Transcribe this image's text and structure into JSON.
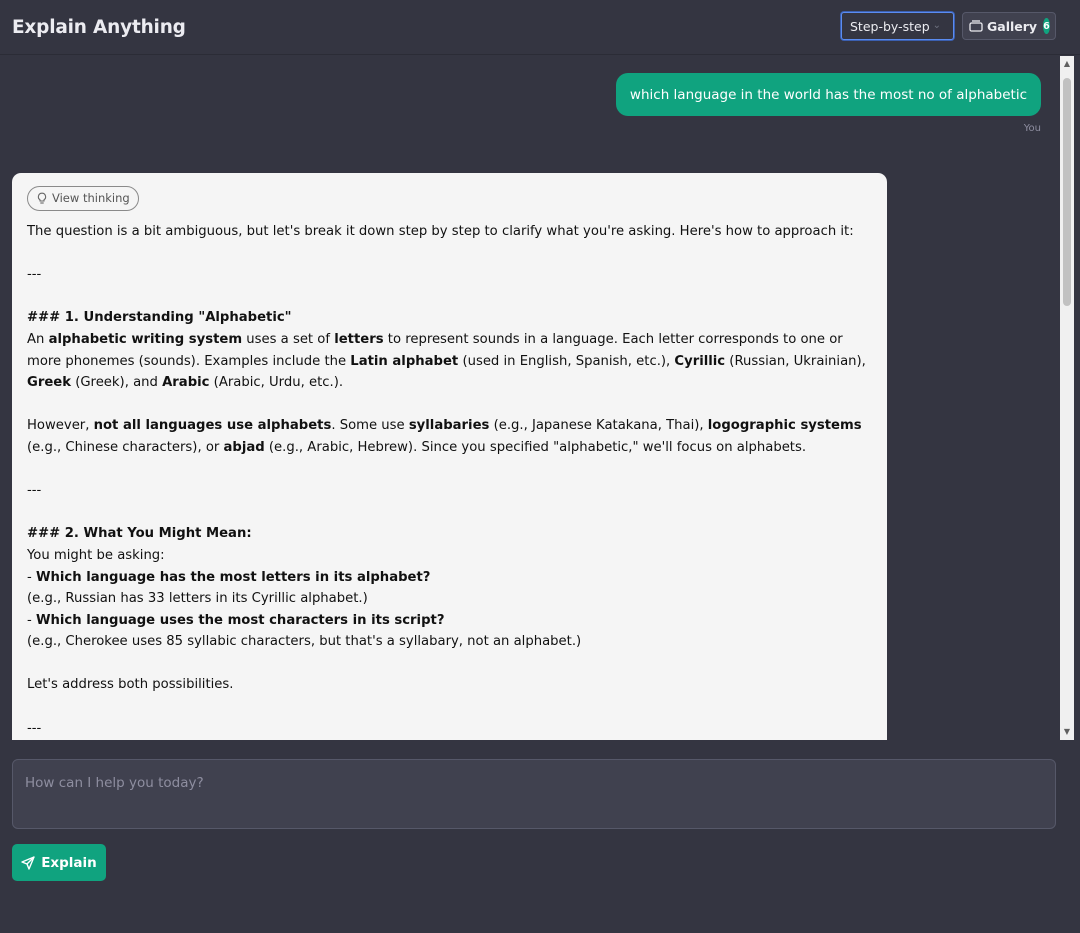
{
  "header": {
    "title": "Explain Anything",
    "mode_select": {
      "selected": "Step-by-step"
    },
    "gallery": {
      "label": "Gallery",
      "count": "6"
    }
  },
  "chat": {
    "user_message": "which language in the world has the most no of alphabetic",
    "user_label": "You",
    "assistant": {
      "thinking_label": "View thinking",
      "intro": "The question is a bit ambiguous, but let's break it down step by step to clarify what you're asking. Here's how to approach it:",
      "sep": "---",
      "s1_heading": "### 1. Understanding \"Alphabetic\"",
      "s1_p1": {
        "t1": "An ",
        "b1": "alphabetic writing system",
        "t2": " uses a set of ",
        "b2": "letters",
        "t3": " to represent sounds in a language. Each letter corresponds to one or more phonemes (sounds). Examples include the ",
        "b3": "Latin alphabet",
        "t4": " (used in English, Spanish, etc.), ",
        "b4": "Cyrillic",
        "t5": " (Russian, Ukrainian), ",
        "b5": "Greek",
        "t6": " (Greek), and ",
        "b6": "Arabic",
        "t7": " (Arabic, Urdu, etc.)."
      },
      "s1_p2": {
        "t1": "However, ",
        "b1": "not all languages use alphabets",
        "t2": ". Some use ",
        "b2": "syllabaries",
        "t3": " (e.g., Japanese Katakana, Thai), ",
        "b3": "logographic systems",
        "t4": " (e.g., Chinese characters), or ",
        "b4": "abjad",
        "t5": " (e.g., Arabic, Hebrew). Since you specified \"alphabetic,\" we'll focus on alphabets."
      },
      "s2_heading": "### 2. What You Might Mean:",
      "s2_intro": "You might be asking:",
      "s2_item1_prefix": "- ",
      "s2_item1": "Which language has the most letters in its alphabet?",
      "s2_item1_note": "(e.g., Russian has 33 letters in its Cyrillic alphabet.)",
      "s2_item2_prefix": "- ",
      "s2_item2": "Which language uses the most characters in its script?",
      "s2_item2_note": "(e.g., Cherokee uses 85 syllabic characters, but that's a syllabary, not an alphabet.)",
      "s2_outro": "Let's address both possibilities."
    }
  },
  "composer": {
    "placeholder": "How can I help you today?",
    "submit_label": "Explain"
  },
  "colors": {
    "background": "#343541",
    "accent": "#10a37f",
    "card": "#f5f5f5"
  }
}
